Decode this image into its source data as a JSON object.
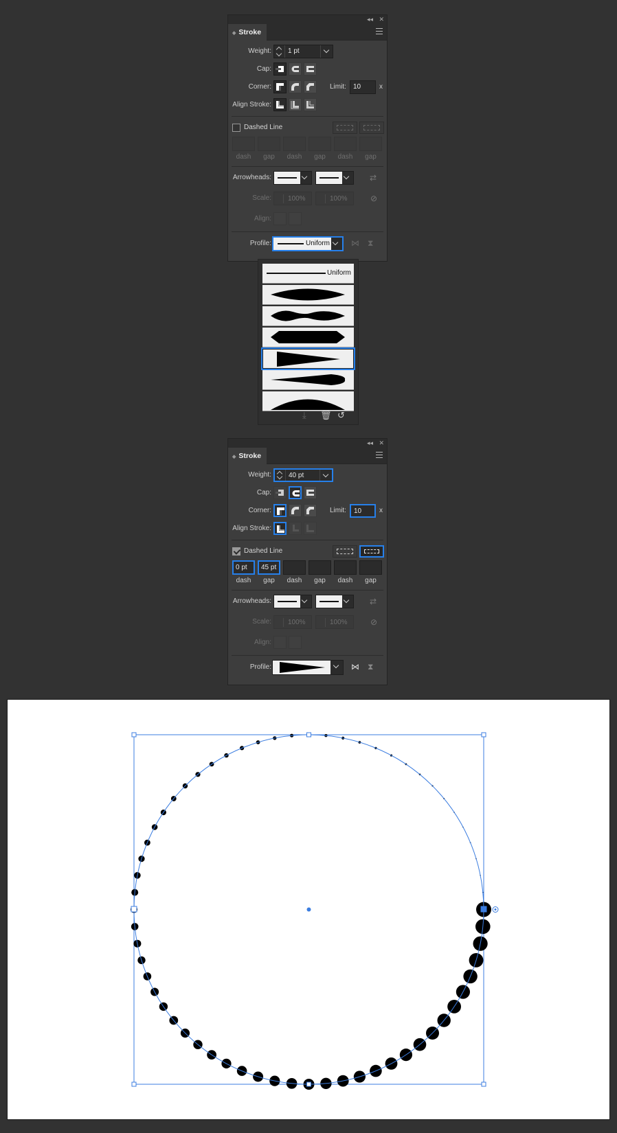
{
  "panel1": {
    "title": "Stroke",
    "collapse_glyph": "◂◂",
    "close_glyph": "✕",
    "weight_label": "Weight:",
    "weight_value": "1 pt",
    "cap_label": "Cap:",
    "corner_label": "Corner:",
    "limit_label": "Limit:",
    "limit_value": "10",
    "limit_unit": "x",
    "align_stroke_label": "Align Stroke:",
    "dashed_line_label": "Dashed Line",
    "dashed_checked": false,
    "dash_labels": [
      "dash",
      "gap",
      "dash",
      "gap",
      "dash",
      "gap"
    ],
    "arrowheads_label": "Arrowheads:",
    "scale_label": "Scale:",
    "scale_value_1": "100%",
    "scale_value_2": "100%",
    "align_label": "Align:",
    "profile_label": "Profile:",
    "profile_value": "Uniform"
  },
  "profile_popup": {
    "options": [
      "Uniform",
      "width-profile-1",
      "width-profile-2",
      "width-profile-3",
      "width-profile-4",
      "width-profile-5",
      "width-profile-6"
    ],
    "selected_index": 4
  },
  "panel2": {
    "title": "Stroke",
    "collapse_glyph": "◂◂",
    "close_glyph": "✕",
    "weight_label": "Weight:",
    "weight_value": "40 pt",
    "cap_label": "Cap:",
    "corner_label": "Corner:",
    "limit_label": "Limit:",
    "limit_value": "10",
    "limit_unit": "x",
    "align_stroke_label": "Align Stroke:",
    "dashed_line_label": "Dashed Line",
    "dashed_checked": true,
    "dash_value": "0 pt",
    "gap_value": "45 pt",
    "dash_labels": [
      "dash",
      "gap",
      "dash",
      "gap",
      "dash",
      "gap"
    ],
    "arrowheads_label": "Arrowheads:",
    "scale_label": "Scale:",
    "scale_value_1": "100%",
    "scale_value_2": "100%",
    "align_label": "Align:",
    "profile_label": "Profile:"
  },
  "colors": {
    "selection_blue": "#2680eb",
    "path_blue": "#3b7de0",
    "panel_bg": "#3d3d3d",
    "app_bg": "#323232"
  }
}
